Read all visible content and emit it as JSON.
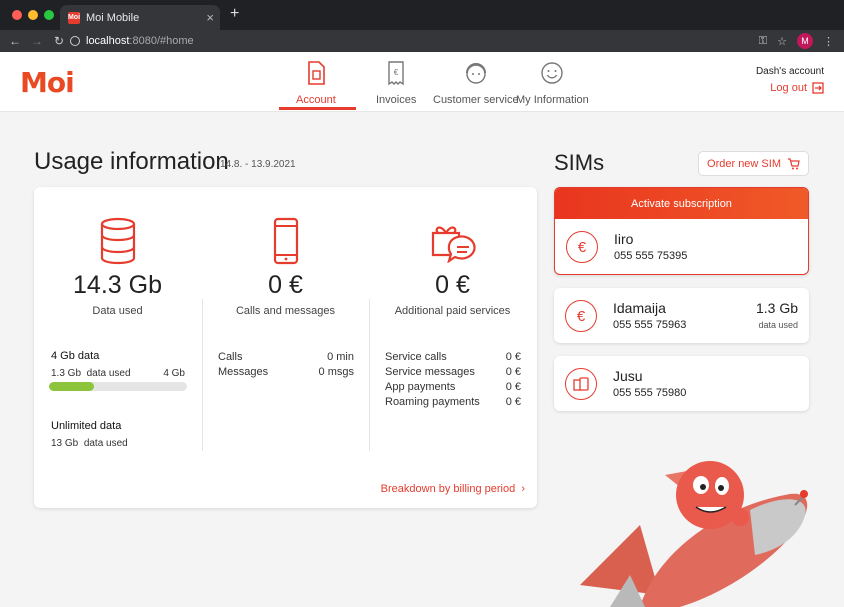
{
  "browser": {
    "tab_title": "Moi Mobile",
    "tab_favicon": "Moi",
    "url_host": "localhost",
    "url_rest": ":8080/#home",
    "profile_initial": "M"
  },
  "header": {
    "logo": "Moi",
    "nav": [
      {
        "label": "Account",
        "icon": "sim-card-icon",
        "active": true
      },
      {
        "label": "Invoices",
        "icon": "invoice-icon",
        "active": false
      },
      {
        "label": "Customer service",
        "icon": "customer-service-icon",
        "active": false
      },
      {
        "label": "My Information",
        "icon": "smiley-icon",
        "active": false
      }
    ],
    "account_name": "Dash's account",
    "logout_label": "Log out"
  },
  "usage": {
    "title": "Usage information",
    "period": "14.8. - 13.9.2021",
    "columns": [
      {
        "value": "14.3 Gb",
        "label": "Data used",
        "icon": "database-icon"
      },
      {
        "value": "0 €",
        "label": "Calls and messages",
        "icon": "phone-icon"
      },
      {
        "value": "0 €",
        "label": "Additional paid services",
        "icon": "gift-message-icon"
      }
    ],
    "data_plans": [
      {
        "title": "4 Gb data",
        "used": "1.3 Gb",
        "used_label": "data used",
        "limit": "4 Gb",
        "fraction": 0.325
      },
      {
        "title": "Unlimited data",
        "used": "13 Gb",
        "used_label": "data used"
      }
    ],
    "calls": [
      {
        "label": "Calls",
        "value": "0 min"
      },
      {
        "label": "Messages",
        "value": "0 msgs"
      }
    ],
    "services": [
      {
        "label": "Service calls",
        "value": "0 €"
      },
      {
        "label": "Service messages",
        "value": "0 €"
      },
      {
        "label": "App payments",
        "value": "0 €"
      },
      {
        "label": "Roaming payments",
        "value": "0 €"
      }
    ],
    "breakdown_label": "Breakdown by billing period"
  },
  "sims": {
    "title": "SIMs",
    "order_label": "Order new SIM",
    "activate_label": "Activate subscription",
    "list": [
      {
        "name": "Iiro",
        "number": "055 555 75395",
        "icon": "euro-icon"
      },
      {
        "name": "Idamaija",
        "number": "055 555 75963",
        "data": "1.3 Gb",
        "data_label": "data used",
        "icon": "euro-icon"
      },
      {
        "name": "Jusu",
        "number": "055 555 75980",
        "icon": "sim-phone-icon"
      }
    ]
  },
  "colors": {
    "accent": "#e53c2e",
    "progress": "#8cc43c",
    "background": "#f4f4f4"
  }
}
